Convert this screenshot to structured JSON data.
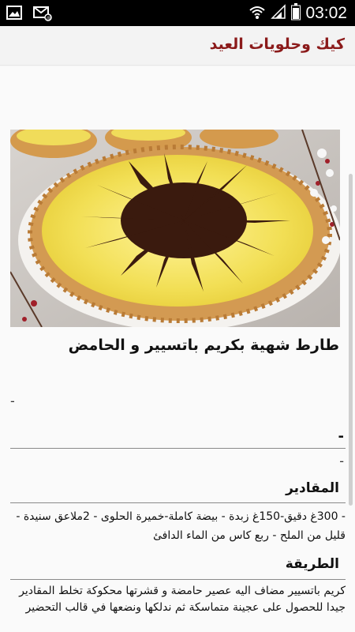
{
  "status_bar": {
    "time": "03:02",
    "icons": [
      "image-notification-icon",
      "email-notification-icon",
      "wifi-icon",
      "signal-icon",
      "battery-icon"
    ]
  },
  "app_bar": {
    "title": "كيك وحلويات العيد"
  },
  "recipe": {
    "title": "طارط شهية بكريم باتسيير و الحامض",
    "dash_1": "-",
    "dash_2": "-",
    "dash_3": "-",
    "ingredients_heading": "المقادير",
    "ingredients_text": "- 300غ دقيق-150غ زبدة - بيضة كاملة-خميرة الحلوى - 2ملاعق سنيدة - قليل من الملح - ربع كاس من الماء الدافئ",
    "method_heading": "الطريقة",
    "method_text": "كريم باتسيير مضاف اليه عصير حامضة و قشرتها محكوكة تخلط المقادير جيدا للحصول على عجينة متماسكة ثم ندلكها ونضعها في قالب التحضير"
  },
  "colors": {
    "title_accent": "#8b1a1a",
    "status_bar_bg": "#000000"
  }
}
